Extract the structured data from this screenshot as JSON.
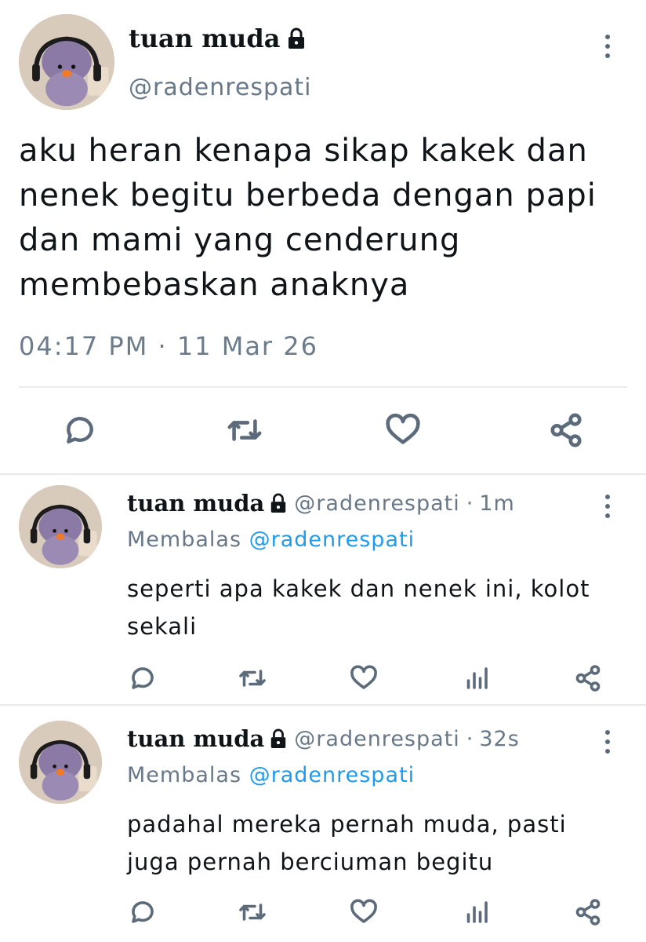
{
  "main_tweet": {
    "display_name": "tuan muda",
    "handle": "@radenrespati",
    "text_lines": [
      "aku heran kenapa sikap kakek dan",
      "nenek begitu berbeda dengan papi",
      "dan mami yang cenderung",
      "membebaskan anaknya"
    ],
    "time": "04:17 PM",
    "date": "11 Mar 26",
    "icons": {
      "locked": "lock-icon",
      "more": "more-vertical-icon",
      "reply": "reply-icon",
      "retweet": "retweet-icon",
      "like": "heart-icon",
      "share": "share-icon"
    }
  },
  "replies": [
    {
      "display_name": "tuan muda",
      "handle": "@radenrespati",
      "age": "1m",
      "replying_label": "Membalas",
      "replying_to": "@radenrespati",
      "text_lines": [
        "seperti apa kakek dan nenek ini, kolot",
        "sekali"
      ]
    },
    {
      "display_name": "tuan muda",
      "handle": "@radenrespati",
      "age": "32s",
      "replying_label": "Membalas",
      "replying_to": "@radenrespati",
      "text_lines": [
        "padahal mereka pernah muda, pasti",
        "juga pernah berciuman begitu"
      ]
    }
  ],
  "separator": "·",
  "colors": {
    "text": "#0f1419",
    "muted": "#66788a",
    "link": "#1d9bf0",
    "divider": "#e7ebee"
  }
}
